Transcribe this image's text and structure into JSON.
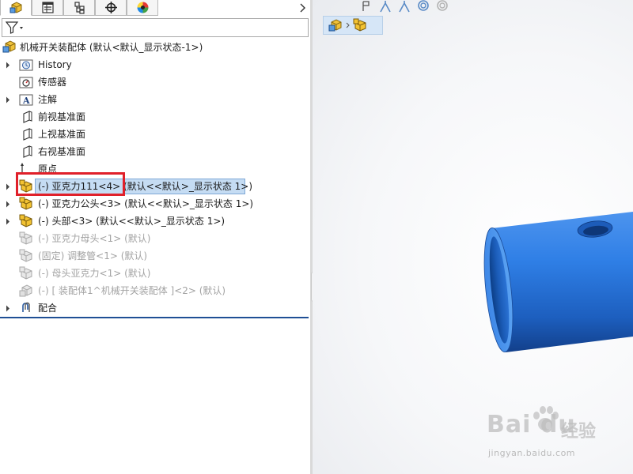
{
  "tabs": [
    {
      "id": "feature-manager",
      "icon": "assembly-icon",
      "active": true
    },
    {
      "id": "property-manager",
      "icon": "property-list-icon",
      "active": false
    },
    {
      "id": "configuration-manager",
      "icon": "configuration-icon",
      "active": false
    },
    {
      "id": "dimxpert-manager",
      "icon": "crosshair-icon",
      "active": false
    },
    {
      "id": "display-manager",
      "icon": "color-wheel-icon",
      "active": false
    }
  ],
  "filter": {
    "icon": "filter-icon"
  },
  "tree": {
    "root_label": "机械开关装配体  (默认<默认_显示状态-1>)",
    "items": [
      {
        "label": "History",
        "icon": "history-folder-icon",
        "expandable": true
      },
      {
        "label": "传感器",
        "icon": "sensor-folder-icon",
        "expandable": false
      },
      {
        "label": "注解",
        "icon": "annotation-folder-icon",
        "expandable": true
      },
      {
        "label": "前视基准面",
        "icon": "plane-icon",
        "expandable": false
      },
      {
        "label": "上视基准面",
        "icon": "plane-icon",
        "expandable": false
      },
      {
        "label": "右视基准面",
        "icon": "plane-icon",
        "expandable": false
      },
      {
        "label": "原点",
        "icon": "origin-icon",
        "expandable": false
      },
      {
        "label": "(-) 亚克力111<4> (默认<<默认>_显示状态 1>)",
        "icon": "part-icon",
        "expandable": true,
        "selected": true
      },
      {
        "label": "(-) 亚克力公头<3> (默认<<默认>_显示状态 1>)",
        "icon": "part-icon",
        "expandable": true
      },
      {
        "label": "(-) 头部<3> (默认<<默认>_显示状态 1>)",
        "icon": "part-icon",
        "expandable": true
      },
      {
        "label": "(-) 亚克力母头<1> (默认)",
        "icon": "suppressed-part-icon",
        "expandable": false,
        "suppressed": true
      },
      {
        "label": "(固定) 调整管<1> (默认)",
        "icon": "suppressed-part-icon",
        "expandable": false,
        "suppressed": true
      },
      {
        "label": "(-) 母头亚克力<1> (默认)",
        "icon": "suppressed-part-icon",
        "expandable": false,
        "suppressed": true
      },
      {
        "label": "(-) [ 装配体1^机械开关装配体 ]<2> (默认)",
        "icon": "suppressed-subassembly-icon",
        "expandable": false,
        "suppressed": true
      },
      {
        "label": "配合",
        "icon": "mates-icon",
        "expandable": true
      }
    ]
  },
  "graphics": {
    "toolbar_icons": [
      "select-icon",
      "sketch-line-icon",
      "sketch-line-icon",
      "circle-icon",
      "circle-icon"
    ],
    "breadcrumb_icons": [
      "assembly-icon",
      "part-icon"
    ],
    "model_color": "#1e6fd9",
    "watermark": {
      "brand": "Bai  du",
      "jingyan": "经验",
      "url": "jingyan.baidu.com"
    }
  }
}
